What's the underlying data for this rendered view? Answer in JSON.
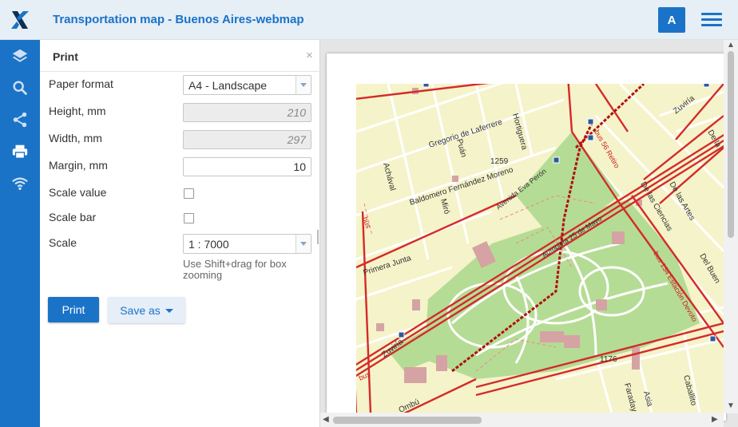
{
  "header": {
    "title": "Transportation map - Buenos Aires-webmap",
    "user_initial": "A"
  },
  "sidebar": {
    "items": [
      {
        "name": "layers-icon"
      },
      {
        "name": "search-icon"
      },
      {
        "name": "share-icon"
      },
      {
        "name": "print-icon"
      },
      {
        "name": "wifi-icon"
      }
    ]
  },
  "panel": {
    "title": "Print",
    "close": "×",
    "paper_format_label": "Paper format",
    "paper_format_value": "A4 - Landscape",
    "height_label": "Height, mm",
    "height_value": "210",
    "width_label": "Width, mm",
    "width_value": "297",
    "margin_label": "Margin, mm",
    "margin_value": "10",
    "scale_value_label": "Scale value",
    "scale_bar_label": "Scale bar",
    "scale_label": "Scale",
    "scale_value": "1 : 7000",
    "hint": "Use Shift+drag for box zooming",
    "print_button": "Print",
    "save_as_button": "Save as"
  },
  "map": {
    "labels": {
      "gregorio": "Gregorio de Laferrere",
      "hortiguera": "Hortiguera",
      "puan": "Puán",
      "baldomero": "Baldomero Fernández Moreno",
      "achaval": "Achával",
      "miro": "Miró",
      "avenida_eva": "Avenida Eva Perón",
      "autopista": "Autopista 25 de Mayo",
      "primera_junta": "Primera Junta",
      "zuviria_bottom": "Zuviría",
      "zuviria_top": "Zuviría",
      "de_la": "De la",
      "de_las_ciencias": "De las Ciencias",
      "de_las_artes": "De las Artes",
      "del_buen": "Del Buen",
      "bus_134": "bus 134 Estación Devoto",
      "bus_left": "bus",
      "bus_56": "bus 56 Retiro",
      "n1259": "1259",
      "n1176": "1176",
      "faraday": "Faraday",
      "asia": "Asia",
      "caballito": "Caballito",
      "ombu": "Ombú",
      "bus_bottom": "bus"
    }
  },
  "colors": {
    "accent": "#1a73c7",
    "road": "#d42a2a",
    "park": "#b5dc94",
    "land": "#f5f3c9"
  }
}
